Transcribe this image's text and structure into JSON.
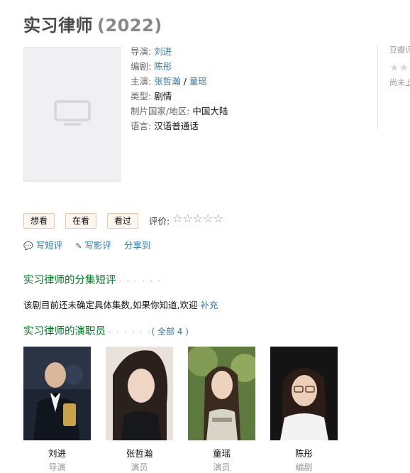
{
  "title": "实习律师",
  "year": "(2022)",
  "info": {
    "director_label": "导演:",
    "director": "刘进",
    "writer_label": "编剧:",
    "writer": "陈彤",
    "stars_label": "主演:",
    "star1": "张哲瀚",
    "star_sep": "/",
    "star2": "童瑶",
    "genre_label": "类型:",
    "genre": "剧情",
    "country_label": "制片国家/地区:",
    "country": "中国大陆",
    "language_label": "语言:",
    "language": "汉语普通话"
  },
  "sidebar": {
    "brand": "豆瓣评",
    "stars": "★★",
    "no_rating": "尚未上"
  },
  "buttons": {
    "want": "想看",
    "watching": "在看",
    "watched": "看过"
  },
  "rating": {
    "label": "评价:",
    "stars": [
      "☆",
      "☆",
      "☆",
      "☆",
      "☆"
    ]
  },
  "actions": {
    "short_review": "写短评",
    "review": "写影评",
    "share": "分享到"
  },
  "episode_section": {
    "title": "实习律师的分集短评",
    "dots": "· · · · · ·",
    "text": "该剧目前还未确定具体集数,如果你知道,欢迎",
    "link": "补充"
  },
  "cast_section": {
    "title": "实习律师的演职员",
    "dots": "· · · · · ·",
    "all": "( 全部 4 )"
  },
  "cast": [
    {
      "name": "刘进",
      "role": "导演"
    },
    {
      "name": "张哲瀚",
      "role": "演员"
    },
    {
      "name": "童瑶",
      "role": "演员"
    },
    {
      "name": "陈彤",
      "role": "编剧"
    }
  ],
  "colors": {
    "link": "#3377aa",
    "section": "#007722",
    "button_bg": "#fff7ef"
  }
}
